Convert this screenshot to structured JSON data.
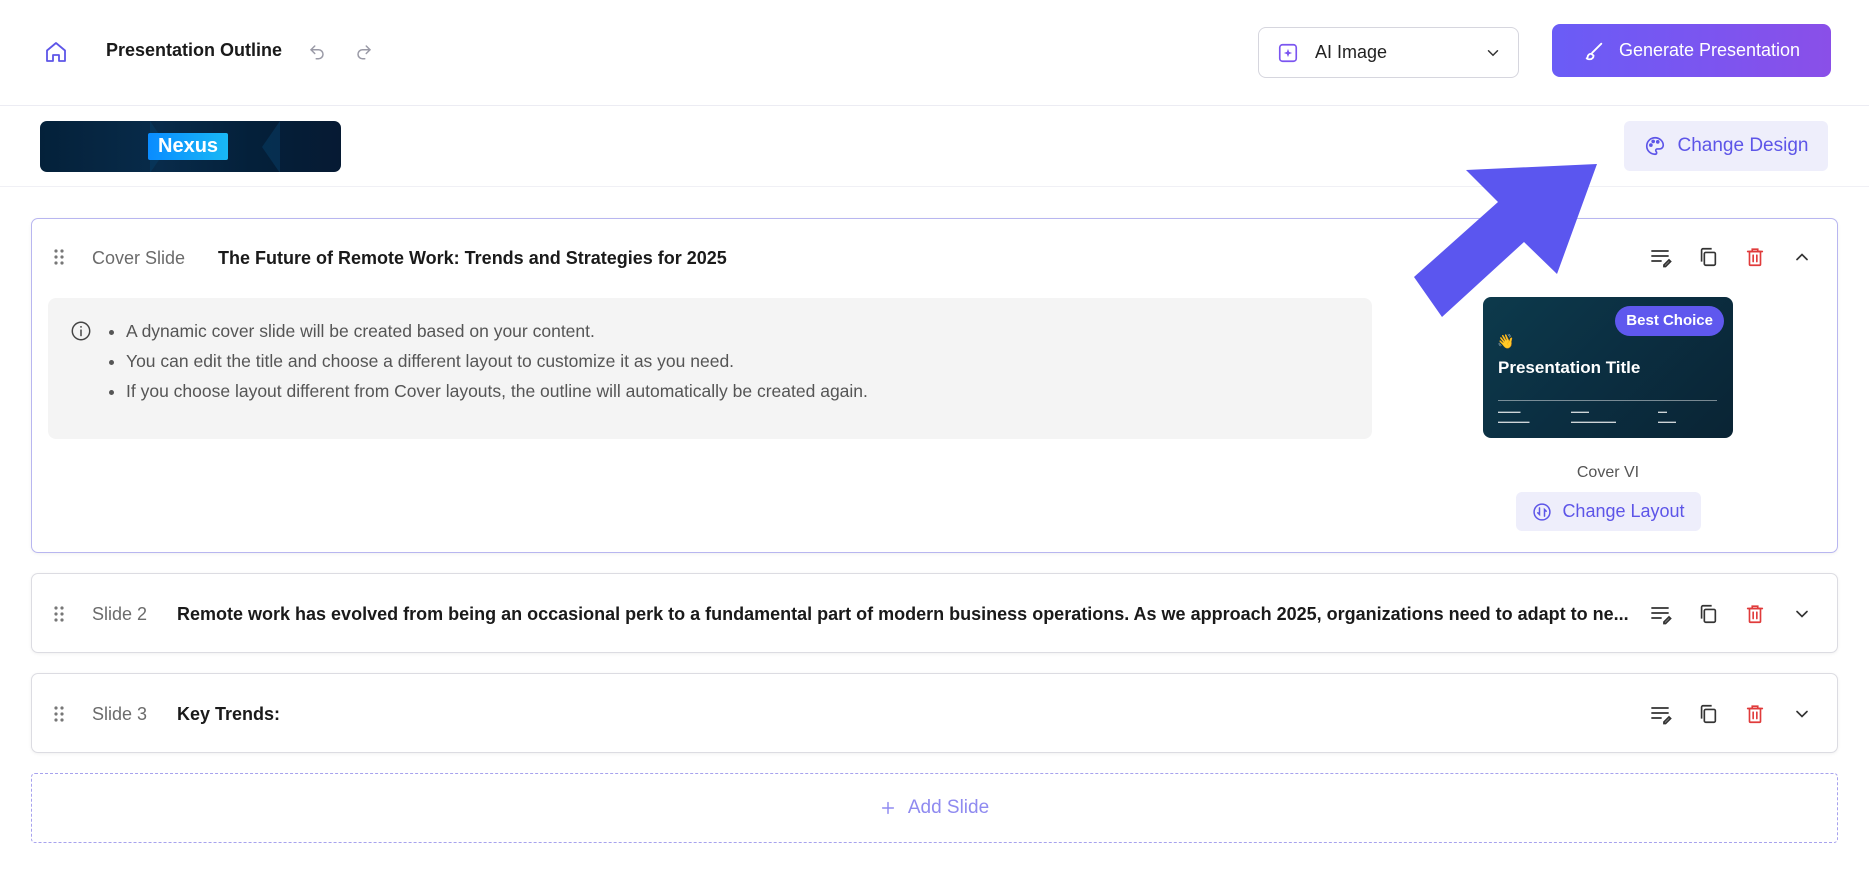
{
  "header": {
    "title": "Presentation Outline",
    "image_mode": "AI Image",
    "generate_label": "Generate Presentation",
    "accent": "#6a5cf6"
  },
  "design": {
    "theme_name": "Nexus",
    "change_design_label": "Change Design"
  },
  "slides": [
    {
      "label": "Cover Slide",
      "title": "The Future of Remote Work: Trends and Strategies for 2025",
      "expanded": true,
      "info": [
        "A dynamic cover slide will be created based on your content.",
        "You can edit the title and choose a different layout to customize it as you need.",
        "If you choose layout different from Cover layouts, the outline will automatically be created again."
      ],
      "preview": {
        "badge": "Best Choice",
        "title": "Presentation Title"
      },
      "layout_name": "Cover VI",
      "change_layout_label": "Change Layout"
    },
    {
      "label": "Slide 2",
      "title": "Remote work has evolved from being an occasional perk to a fundamental part of modern business operations. As we approach 2025, organizations need to adapt to ne...",
      "expanded": false
    },
    {
      "label": "Slide 3",
      "title": "Key Trends:",
      "expanded": false
    }
  ],
  "add_slide_label": "Add Slide",
  "colors": {
    "delete": "#e03b3b",
    "link": "#5d55e8",
    "arrow": "#5b56ef"
  }
}
